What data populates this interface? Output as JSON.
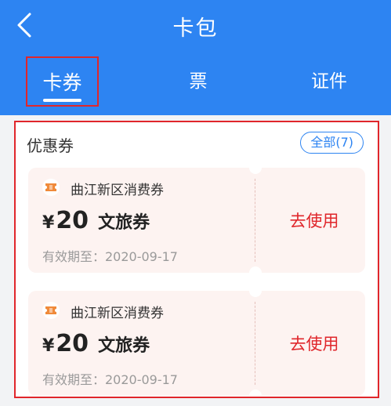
{
  "header": {
    "title": "卡包",
    "back_icon": "chevron-left-icon",
    "tabs": [
      {
        "label": "卡券",
        "active": true
      },
      {
        "label": "票",
        "active": false
      },
      {
        "label": "证件",
        "active": false
      }
    ]
  },
  "section": {
    "title": "优惠券",
    "all_label": "全部(7)"
  },
  "coupons": [
    {
      "issuer": "曲江新区消费券",
      "currency": "¥",
      "amount": "20",
      "type": "文旅券",
      "validity": "有效期至：2020-09-17",
      "action": "去使用"
    },
    {
      "issuer": "曲江新区消费券",
      "currency": "¥",
      "amount": "20",
      "type": "文旅券",
      "validity": "有效期至：2020-09-17",
      "action": "去使用"
    }
  ],
  "colors": {
    "brand": "#2d84f2",
    "action": "#e0262b",
    "coupon_bg": "#fdf3f1"
  }
}
